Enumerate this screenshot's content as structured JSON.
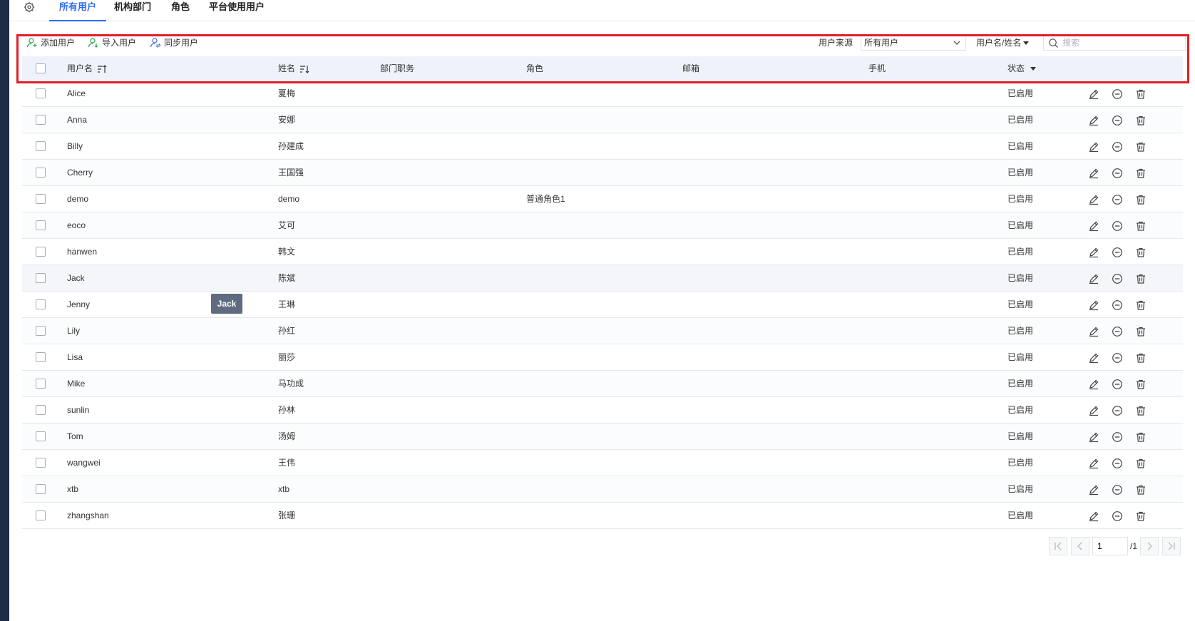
{
  "tabs": [
    {
      "label": "所有用户",
      "active": true
    },
    {
      "label": "机构部门",
      "active": false
    },
    {
      "label": "角色",
      "active": false
    },
    {
      "label": "平台使用用户",
      "active": false
    }
  ],
  "toolbar": {
    "add_label": "添加用户",
    "import_label": "导入用户",
    "sync_label": "同步用户",
    "source_label": "用户来源",
    "source_value": "所有用户",
    "field_select": "用户名/姓名",
    "search_placeholder": "搜索"
  },
  "columns": {
    "username": "用户名",
    "name": "姓名",
    "dept": "部门职务",
    "role": "角色",
    "email": "邮箱",
    "phone": "手机",
    "status": "状态"
  },
  "rows": [
    {
      "username": "Alice",
      "name": "夏梅",
      "role": "",
      "status": "已启用"
    },
    {
      "username": "Anna",
      "name": "安娜",
      "role": "",
      "status": "已启用"
    },
    {
      "username": "Billy",
      "name": "孙建成",
      "role": "",
      "status": "已启用"
    },
    {
      "username": "Cherry",
      "name": "王国强",
      "role": "",
      "status": "已启用"
    },
    {
      "username": "demo",
      "name": "demo",
      "role": "普通角色1",
      "status": "已启用"
    },
    {
      "username": "eoco",
      "name": "艾可",
      "role": "",
      "status": "已启用"
    },
    {
      "username": "hanwen",
      "name": "韩文",
      "role": "",
      "status": "已启用"
    },
    {
      "username": "Jack",
      "name": "陈斌",
      "role": "",
      "status": "已启用"
    },
    {
      "username": "Jenny",
      "name": "王琳",
      "role": "",
      "status": "已启用"
    },
    {
      "username": "Lily",
      "name": "孙红",
      "role": "",
      "status": "已启用"
    },
    {
      "username": "Lisa",
      "name": "丽莎",
      "role": "",
      "status": "已启用"
    },
    {
      "username": "Mike",
      "name": "马功成",
      "role": "",
      "status": "已启用"
    },
    {
      "username": "sunlin",
      "name": "孙林",
      "role": "",
      "status": "已启用"
    },
    {
      "username": "Tom",
      "name": "汤姆",
      "role": "",
      "status": "已启用"
    },
    {
      "username": "wangwei",
      "name": "王伟",
      "role": "",
      "status": "已启用"
    },
    {
      "username": "xtb",
      "name": "xtb",
      "role": "",
      "status": "已启用"
    },
    {
      "username": "zhangshan",
      "name": "张珊",
      "role": "",
      "status": "已启用"
    }
  ],
  "tooltip": "Jack",
  "pagination": {
    "current": "1",
    "total": "/1"
  },
  "colors": {
    "accent": "#2f6df6",
    "highlight": "#e11d2a",
    "header_bg": "#eef3fb"
  }
}
